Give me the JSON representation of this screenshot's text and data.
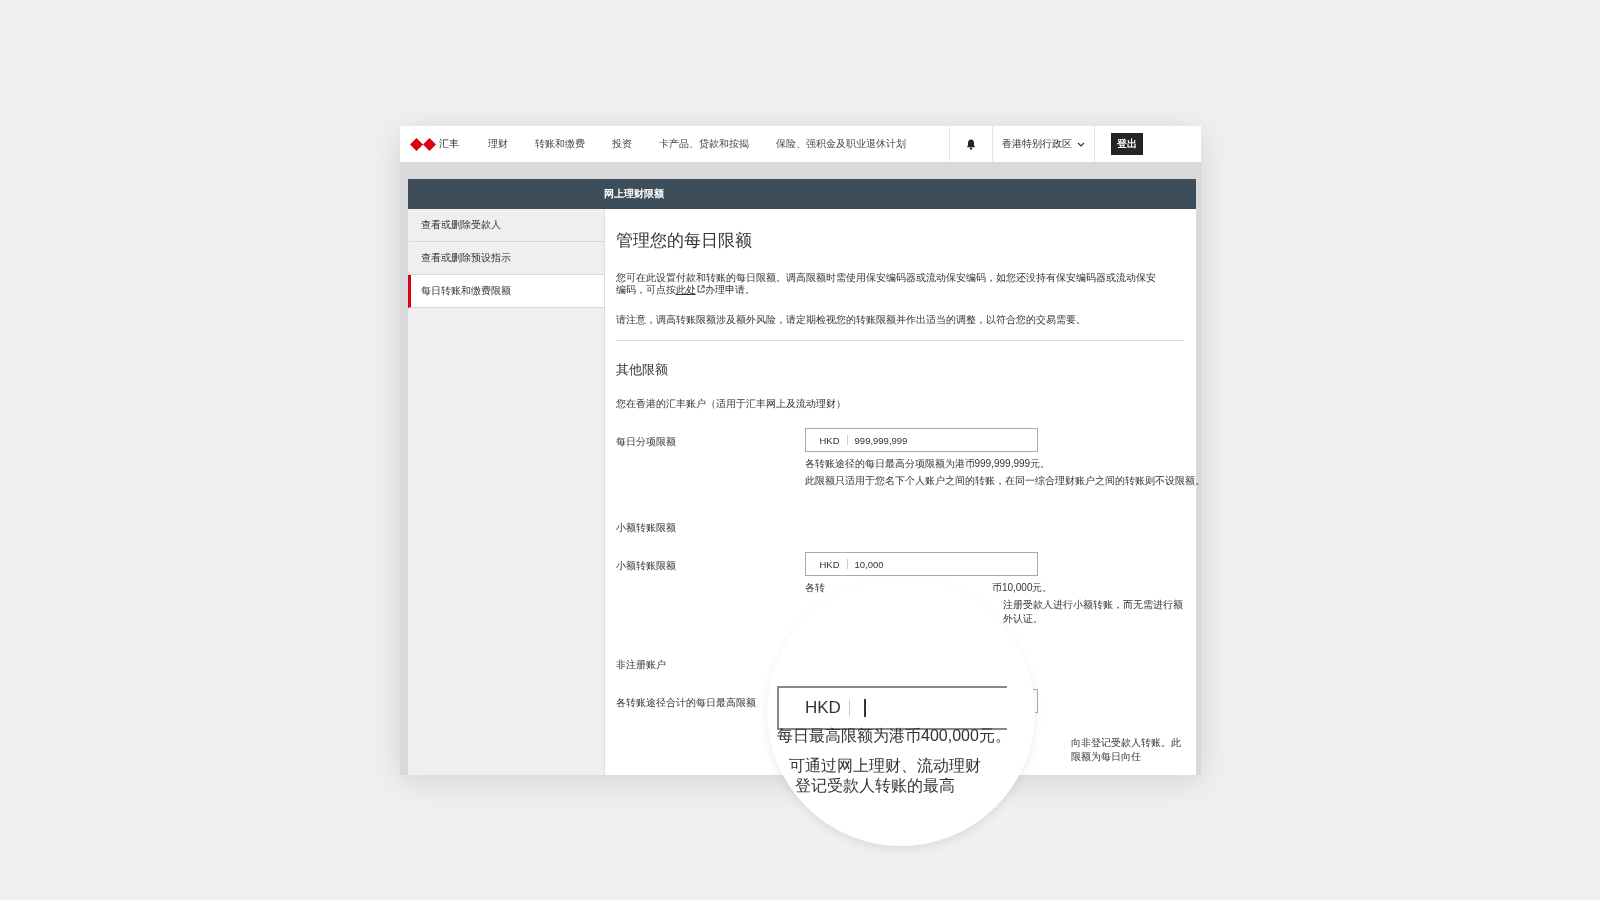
{
  "nav": {
    "logo_text": "汇丰",
    "items": [
      "理财",
      "转账和缴费",
      "投资",
      "卡产品、贷款和按揭",
      "保险、强积金及职业退休计划"
    ],
    "region": "香港特别行政区",
    "logout": "登出"
  },
  "page_header": "网上理财限额",
  "sidebar": {
    "items": [
      {
        "label": "查看或删除受款人",
        "selected": false
      },
      {
        "label": "查看或删除预设指示",
        "selected": false
      },
      {
        "label": "每日转账和缴费限额",
        "selected": true
      }
    ]
  },
  "main": {
    "title": "管理您的每日限额",
    "intro": {
      "text_before": "您可在此设置付款和转账的每日限额。调高限额时需使用保安编码器或流动保安编码，如您还没持有保安编码器或流动保安编码，可点按",
      "link": "此处",
      "text_after": "办理申请。"
    },
    "notice": "请注意，调高转账限额涉及额外风险，请定期检视您的转账限额并作出适当的调整，以符合您的交易需要。",
    "section_title": "其他限额",
    "account_note": "您在香港的汇丰账户（适用于汇丰网上及流动理财）",
    "limits": [
      {
        "label": "每日分项限额",
        "currency": "HKD",
        "value": "999,999,999",
        "help": [
          {
            "kind": "full",
            "parts": [
              "各转账途径的每日最高分项限额为港币999,999,999元。"
            ]
          },
          {
            "kind": "full",
            "parts": [
              "此限额只适用于您名下个人账户之间的转账，在同一综合理财账户之间的转账则不设限额。"
            ]
          }
        ]
      },
      {
        "heading": "小额转账限额",
        "label": "小额转账限额",
        "currency": "HKD",
        "value": "10,000",
        "help": [
          {
            "kind": "split",
            "parts": [
              "各转",
              "币10,000元。"
            ]
          },
          {
            "kind": "right",
            "parts": [
              "注册受款人进行小额转账，而无需进行额外认证。"
            ]
          }
        ]
      },
      {
        "heading": "非注册账户",
        "label": "各转账途径合计的每日最高限额",
        "help": [
          {
            "kind": "far",
            "parts": [
              "向非登记受款人转账。此限额为每日向任"
            ]
          }
        ]
      }
    ]
  },
  "magnifier": {
    "currency": "HKD",
    "lines": [
      "每日最高限额为港币400,000元。",
      "可通过网上理财、流动理财",
      "登记受款人转账的最高"
    ]
  }
}
